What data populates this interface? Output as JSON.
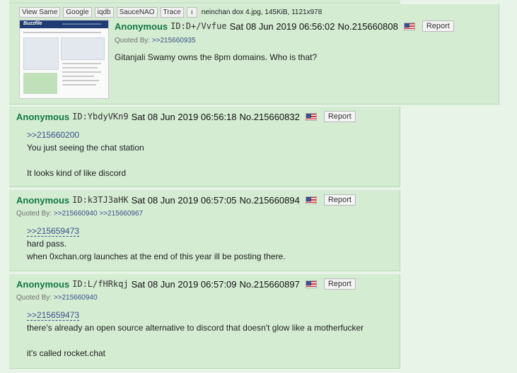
{
  "image_tools": {
    "view_same": "View Same",
    "google": "Google",
    "iqdb": "iqdb",
    "saucenao": "SauceNAO",
    "trace": "Trace",
    "file_info": "neinchan dox 4.jpg, 145KiB, 1121x978"
  },
  "thumbnail": {
    "logo_text": "Buzzfile"
  },
  "report_label": "Report",
  "quoted_by_label": "Quoted By:",
  "posts": [
    {
      "name": "Anonymous",
      "id": "ID:D+/Vvfue",
      "datetime": "Sat 08 Jun 2019 06:56:02",
      "number": "No.215660808",
      "quoted_by": [
        ">>215660935"
      ],
      "lines": [
        "Gitanjali Swamy owns the 8pm domains. Who is that?"
      ]
    },
    {
      "name": "Anonymous",
      "id": "ID:YbdyVKn9",
      "datetime": "Sat 08 Jun 2019 06:56:18",
      "number": "No.215660832",
      "quoted_by": [],
      "lines": [
        ">>215660200",
        "You just seeing the chat station",
        "",
        "It looks kind of like discord"
      ]
    },
    {
      "name": "Anonymous",
      "id": "ID:k3TJ3aHK",
      "datetime": "Sat 08 Jun 2019 06:57:05",
      "number": "No.215660894",
      "quoted_by": [
        ">>215660940",
        ">>215660967"
      ],
      "lines": [
        ">>215659473",
        "hard pass.",
        "when 0xchan.org launches at the end of this year ill be posting there."
      ]
    },
    {
      "name": "Anonymous",
      "id": "ID:L/fHRkqj",
      "datetime": "Sat 08 Jun 2019 06:57:09",
      "number": "No.215660897",
      "quoted_by": [
        ">>215660940"
      ],
      "lines": [
        ">>215659473",
        "there's already an open source alternative to discord that doesn't glow like a motherfucker",
        "",
        "it's called rocket.chat"
      ]
    }
  ]
}
